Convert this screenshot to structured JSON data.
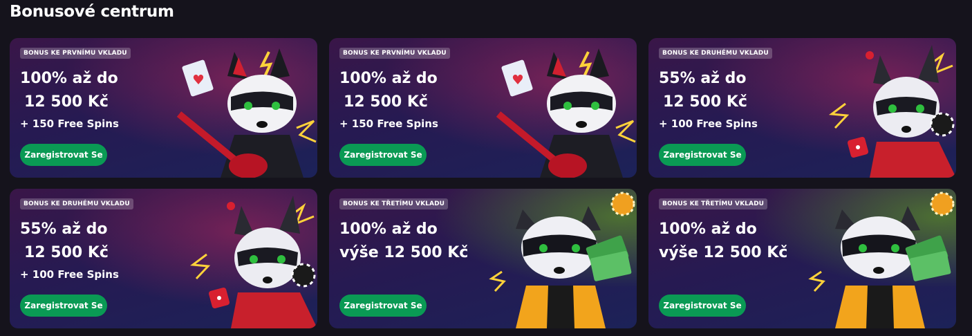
{
  "page": {
    "title": "Bonusové centrum"
  },
  "cards": [
    {
      "badge": "BONUS KE PRVNÍMU VKLADU",
      "line1": "100% až do",
      "line2": "12 500 Kč",
      "spins": "+ 150 Free Spins",
      "cta": "Zaregistrovat Se",
      "art": "raccoon-guitar-art"
    },
    {
      "badge": "BONUS KE PRVNÍMU VKLADU",
      "line1": "100% až do",
      "line2": "12 500 Kč",
      "spins": "+ 150 Free Spins",
      "cta": "Zaregistrovat Se",
      "art": "raccoon-guitar-art"
    },
    {
      "badge": "BONUS KE DRUHÉMU VKLADU",
      "line1": "55% až do",
      "line2": "12 500 Kč",
      "spins": "+ 100 Free Spins",
      "cta": "Zaregistrovat Se",
      "art": "raccoon-dice-art"
    },
    {
      "badge": "BONUS KE DRUHÉMU VKLADU",
      "line1": "55% až do",
      "line2": "12 500 Kč",
      "spins": "+ 100 Free Spins",
      "cta": "Zaregistrovat Se",
      "art": "raccoon-dice-art"
    },
    {
      "badge": "BONUS KE TŘETÍMU VKLADU",
      "line1": "100% až do",
      "line2": "výše  12 500 Kč",
      "spins": "",
      "cta": "Zaregistrovat Se",
      "art": "raccoon-cash-art"
    },
    {
      "badge": "BONUS KE TŘETÍMU VKLADU",
      "line1": "100% až do",
      "line2": "výše  12 500 Kč",
      "spins": "",
      "cta": "Zaregistrovat Se",
      "art": "raccoon-cash-art"
    }
  ],
  "colors": {
    "cta": "#0a9a54",
    "background": "#15131c"
  }
}
